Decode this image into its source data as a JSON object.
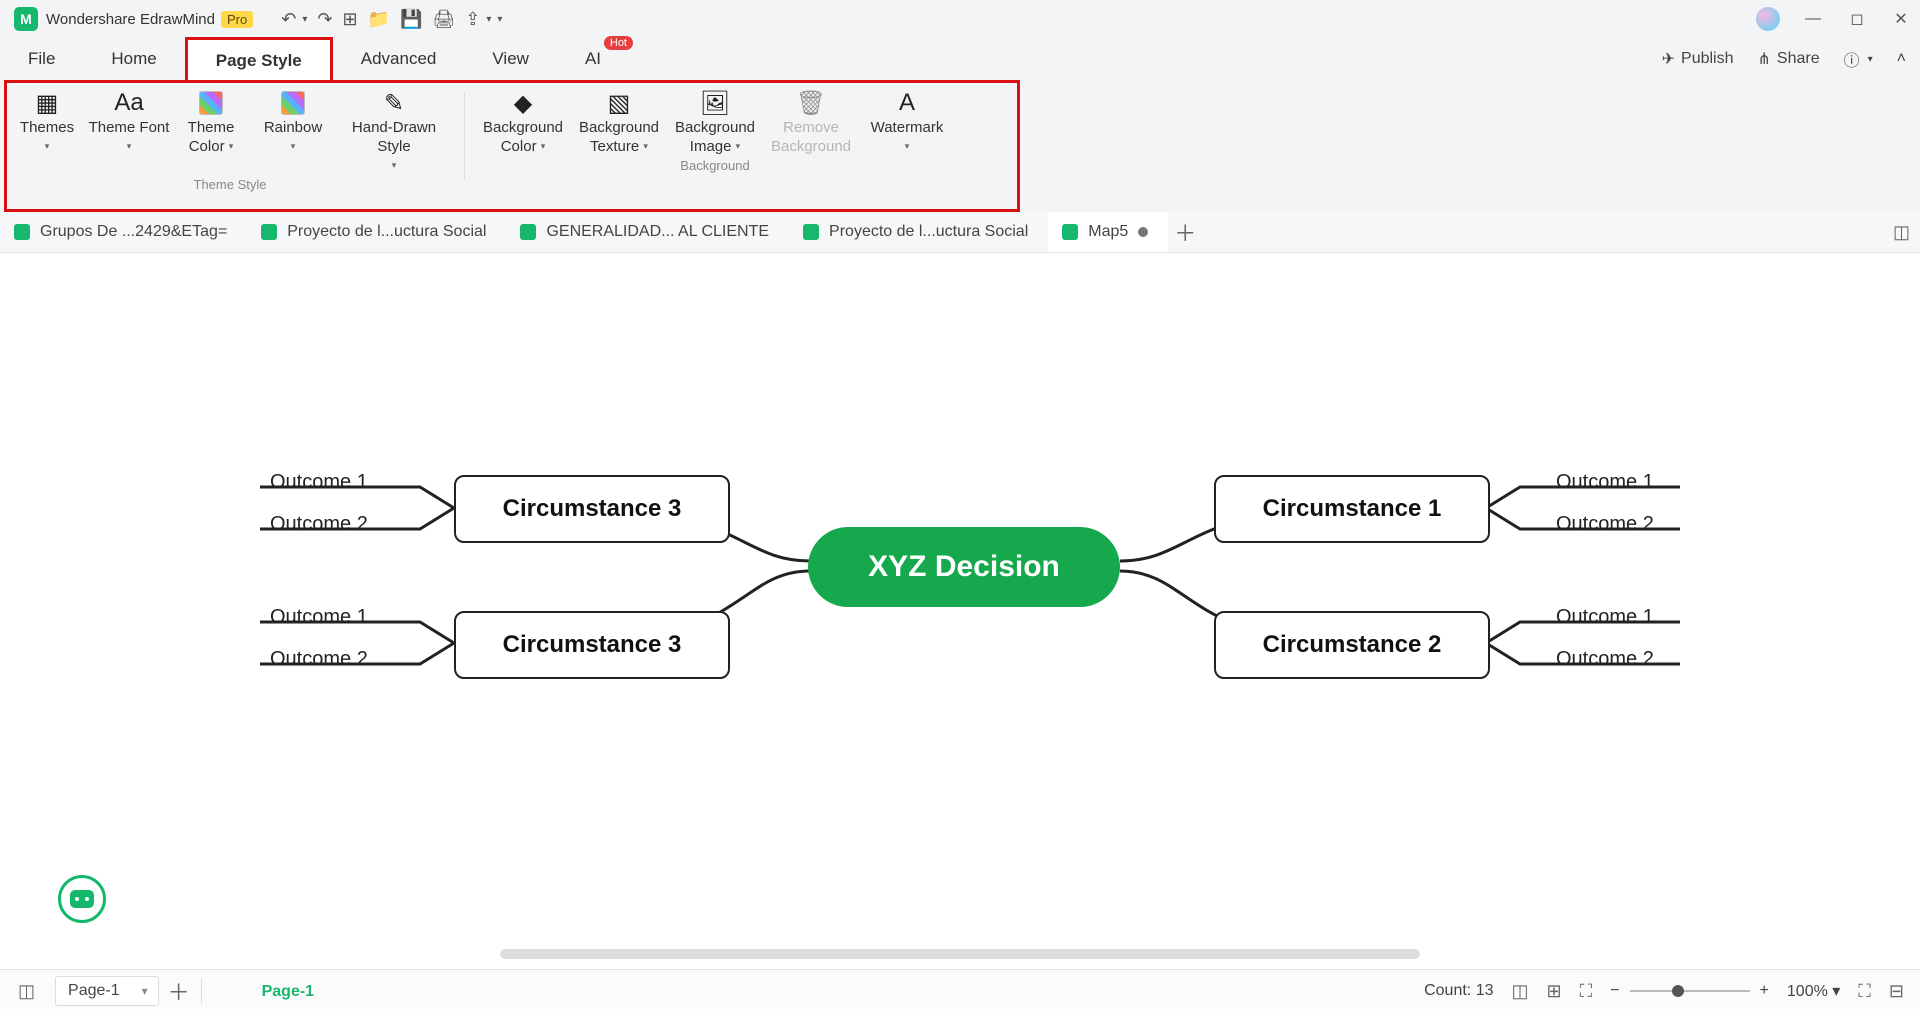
{
  "app": {
    "name": "Wondershare EdrawMind",
    "badge": "Pro"
  },
  "menus": [
    "File",
    "Home",
    "Page Style",
    "Advanced",
    "View",
    "AI"
  ],
  "active_menu": 2,
  "hot_menu": 5,
  "menu_right": {
    "publish": "Publish",
    "share": "Share"
  },
  "ribbon": {
    "theme_style": {
      "themes": "Themes",
      "theme_font": "Theme Font",
      "theme_color": "Theme Color",
      "rainbow": "Rainbow",
      "hand_drawn": "Hand-Drawn Style",
      "group_label": "Theme Style"
    },
    "background": {
      "bg_color": "Background Color",
      "bg_texture": "Background Texture",
      "bg_image": "Background Image",
      "remove_bg": "Remove Background",
      "watermark": "Watermark",
      "group_label": "Background"
    }
  },
  "doc_tabs": [
    {
      "label": "Grupos De ...2429&ETag="
    },
    {
      "label": "Proyecto de l...uctura Social"
    },
    {
      "label": "GENERALIDAD... AL CLIENTE"
    },
    {
      "label": "Proyecto de l...uctura Social"
    },
    {
      "label": "Map5",
      "active": true,
      "dirty": true
    }
  ],
  "mindmap": {
    "center": "XYZ Decision",
    "left": [
      {
        "title": "Circumstance 3",
        "outcomes": [
          "Outcome 1",
          "Outcome 2"
        ]
      },
      {
        "title": "Circumstance 3",
        "outcomes": [
          "Outcome 1",
          "Outcome 2"
        ]
      }
    ],
    "right": [
      {
        "title": "Circumstance 1",
        "outcomes": [
          "Outcome 1",
          "Outcome 2"
        ]
      },
      {
        "title": "Circumstance 2",
        "outcomes": [
          "Outcome 1",
          "Outcome 2"
        ]
      }
    ]
  },
  "status": {
    "page_selector": "Page-1",
    "page_tab": "Page-1",
    "count_label": "Count:",
    "count_value": "13",
    "zoom": "100%"
  }
}
